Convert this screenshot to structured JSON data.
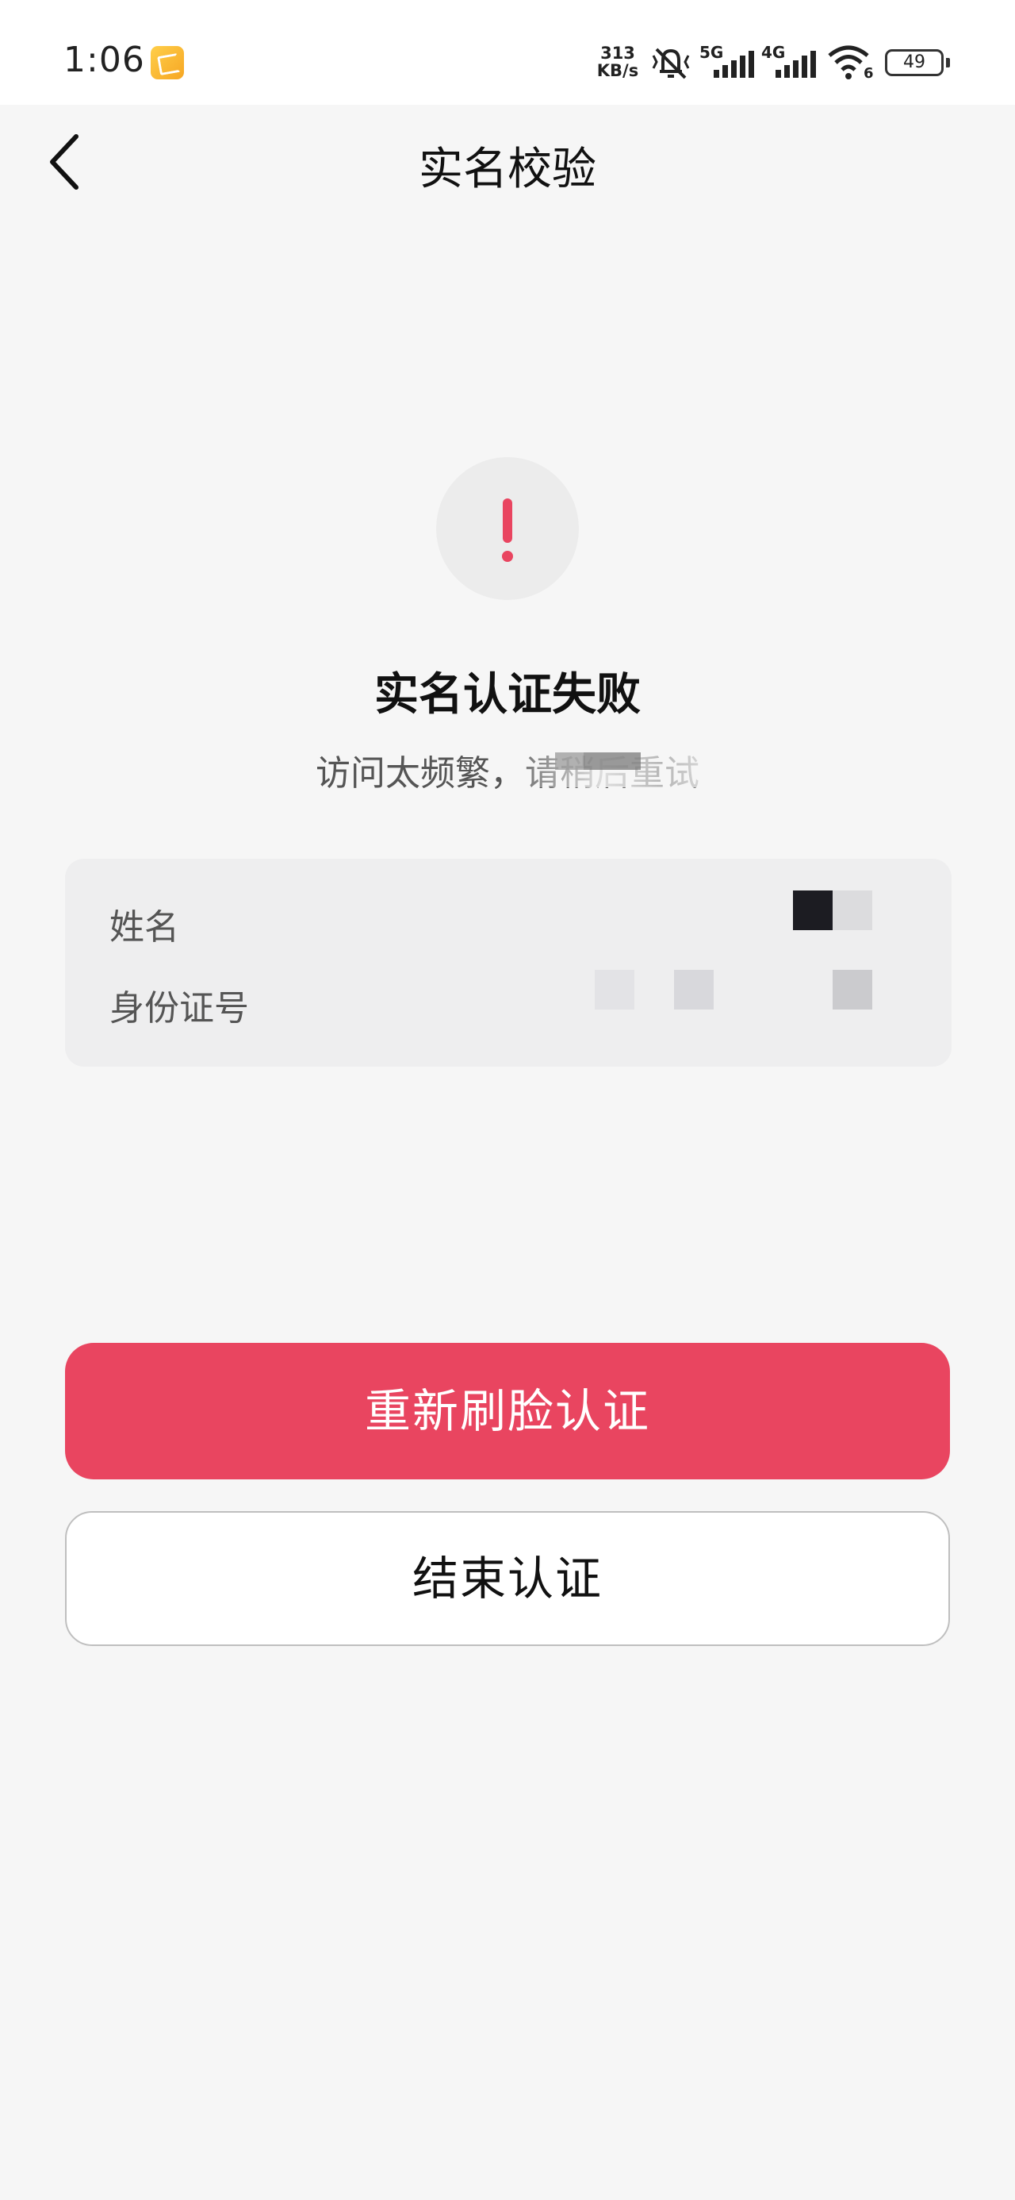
{
  "status_bar": {
    "time": "1:06",
    "net_speed_value": "313",
    "net_speed_unit": "KB/s",
    "signal_1_label": "5G",
    "signal_2_label": "4G",
    "wifi_label": "6",
    "battery": "49"
  },
  "nav": {
    "title": "实名校验"
  },
  "result": {
    "title": "实名认证失败",
    "subtitle": "访问太频繁，请稍后重试"
  },
  "info": {
    "name_label": "姓名",
    "id_label": "身份证号"
  },
  "actions": {
    "retry_label": "重新刷脸认证",
    "end_label": "结束认证"
  },
  "colors": {
    "accent": "#e94560",
    "background": "#f6f6f6"
  }
}
